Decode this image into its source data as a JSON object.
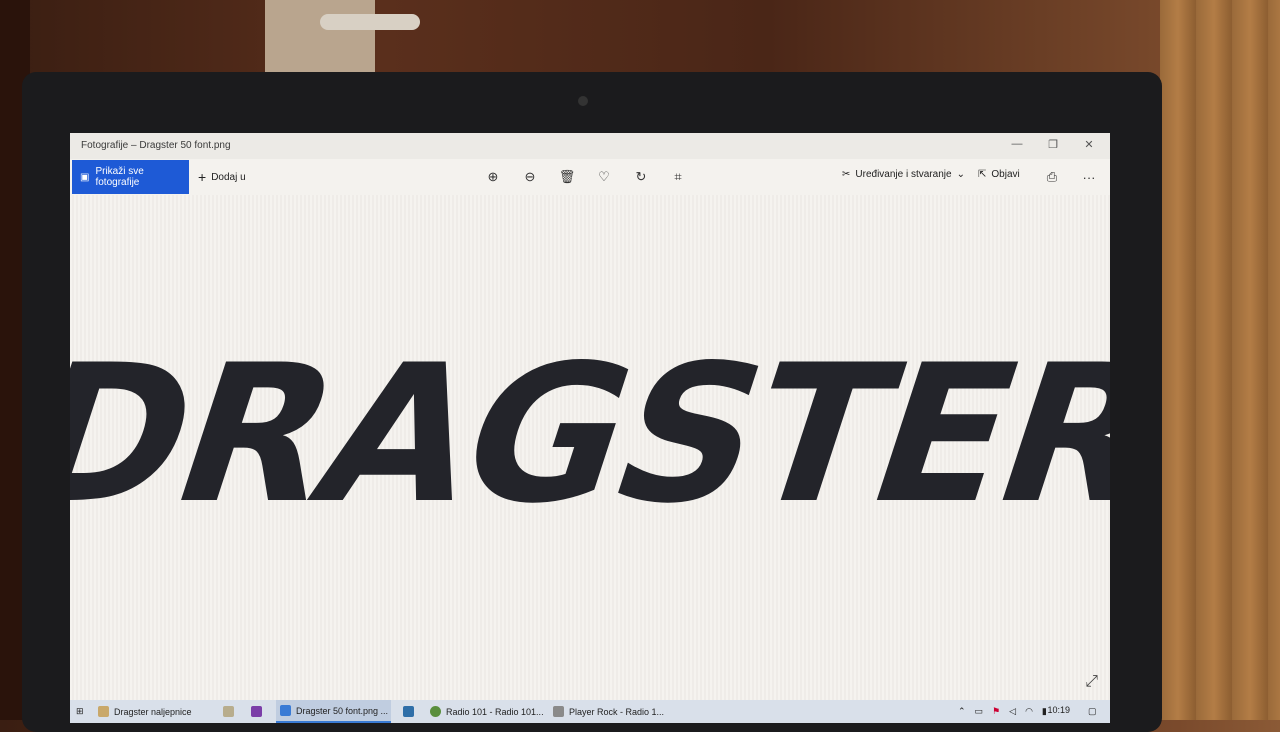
{
  "window": {
    "title": "Fotografije – Dragster 50 font.png",
    "minimize": "—",
    "maximize": "❐",
    "close": "✕"
  },
  "toolbar": {
    "show_all_label": "Prikaži sve fotografije",
    "add_label": "Dodaj u",
    "edit_label": "Uređivanje i stvaranje",
    "share_label": "Objavi",
    "more": "···"
  },
  "image": {
    "text": "DRAGSTER"
  },
  "taskbar": {
    "items": [
      {
        "label": "Dragster naljepnice"
      },
      {
        "label": "Dragster 50 font.png ..."
      },
      {
        "label": "Radio 101 - Radio 101..."
      },
      {
        "label": "Player Rock - Radio 1..."
      }
    ],
    "clock": "10:19"
  },
  "colors": {
    "accent": "#1e5ad6",
    "logo": "#23242a"
  }
}
